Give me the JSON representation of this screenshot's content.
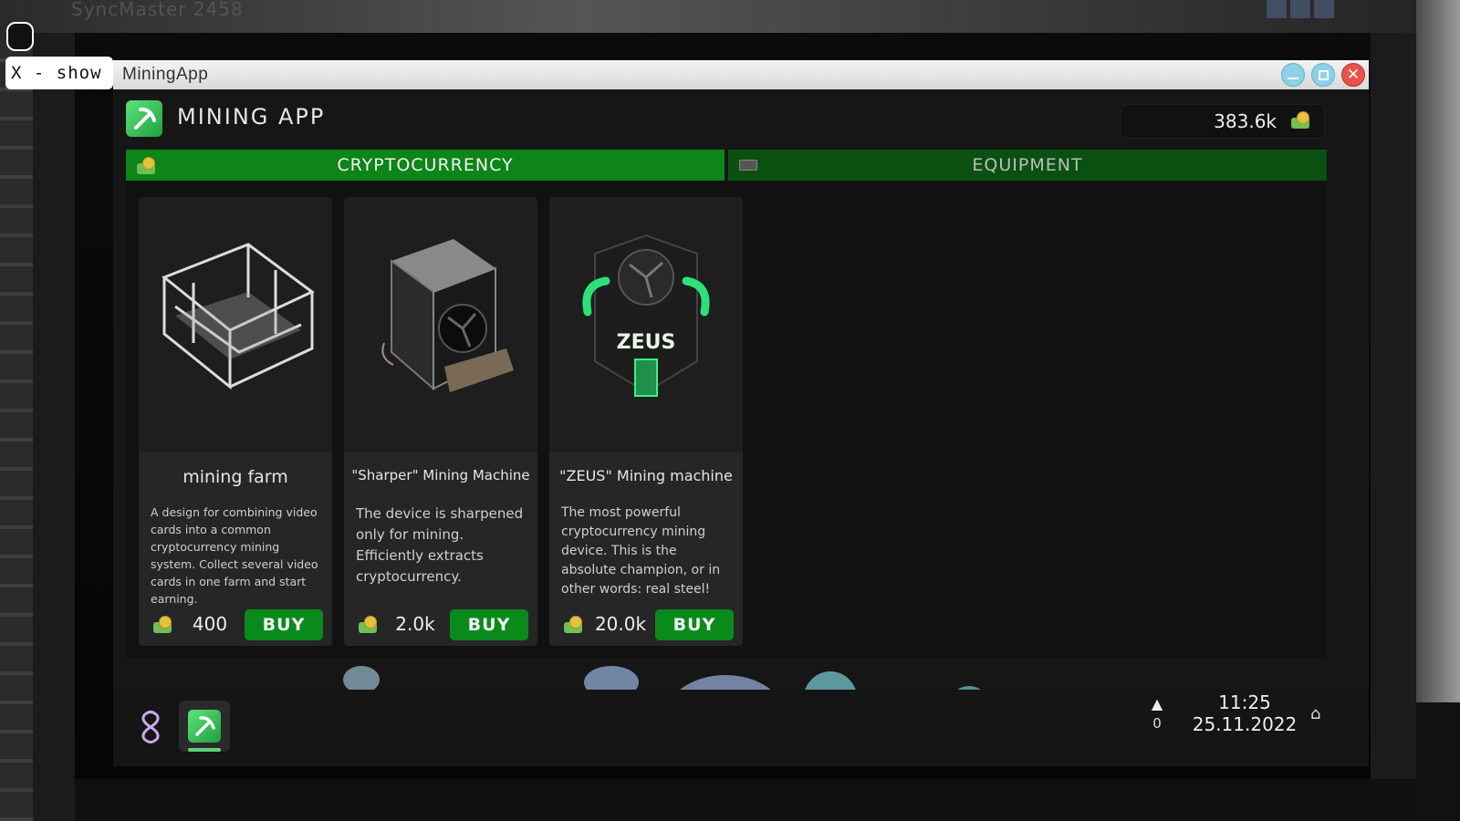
{
  "backdrop": {
    "monitor_brand": "SyncMaster 2458"
  },
  "overlay": {
    "show_hint": "X - show"
  },
  "window": {
    "title": "MiningApp"
  },
  "app": {
    "title": "MINING APP",
    "balance": "383.6k",
    "tabs": [
      {
        "label": "CRYPTOCURRENCY",
        "active": true
      },
      {
        "label": "EQUIPMENT",
        "active": false
      }
    ],
    "products": [
      {
        "name": "mining farm",
        "description": "A design for combining video cards into a common cryptocurrency mining system. Collect several video cards in one farm and start earning.",
        "price": "400",
        "buy_label": "BUY"
      },
      {
        "name": "\"Sharper\" Mining Machine",
        "description": "The device is sharpened only for mining. Efficiently extracts cryptocurrency.",
        "price": "2.0k",
        "buy_label": "BUY"
      },
      {
        "name": "\"ZEUS\" Mining machine",
        "description": "The most powerful cryptocurrency mining device. This is the absolute champion, or in other words: real steel!",
        "price": "20.0k",
        "buy_label": "BUY",
        "device_logo": "ZEUS"
      }
    ]
  },
  "taskbar": {
    "notification_count": "0",
    "time": "11:25",
    "date": "25.11.2022"
  },
  "colors": {
    "accent_green": "#0d8518",
    "tab_inactive": "#0a5011",
    "buy_green": "#0b8a1c",
    "close_red": "#e8534d",
    "window_btn_blue": "#8ed1e7"
  }
}
